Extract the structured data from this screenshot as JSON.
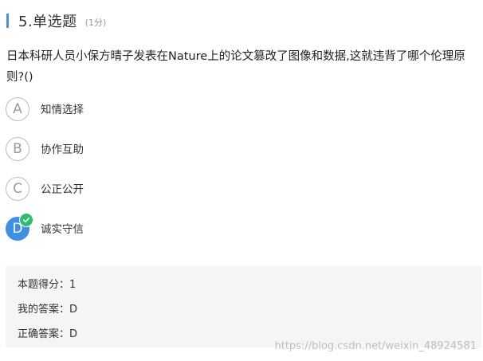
{
  "question": {
    "title": "5.单选题",
    "score": "(1分)",
    "text": "日本科研人员小保方晴子发表在Nature上的论文篡改了图像和数据,这就违背了哪个伦理原则?()"
  },
  "options": [
    {
      "letter": "A",
      "label": "知情选择"
    },
    {
      "letter": "B",
      "label": "协作互助"
    },
    {
      "letter": "C",
      "label": "公正公开"
    },
    {
      "letter": "D",
      "label": "诚实守信",
      "selected": true,
      "correct_icon": "check-icon"
    }
  ],
  "result": {
    "score_line": "本题得分：1",
    "my_answer_line": "我的答案：D",
    "correct_answer_line": "正确答案：D"
  },
  "watermark": "https://blog.csdn.net/weixin_48924581",
  "colors": {
    "accent": "#4a90e2",
    "selected": "#3d8fe8",
    "correct": "#2ebd6b",
    "panel": "#f5f5f5"
  }
}
